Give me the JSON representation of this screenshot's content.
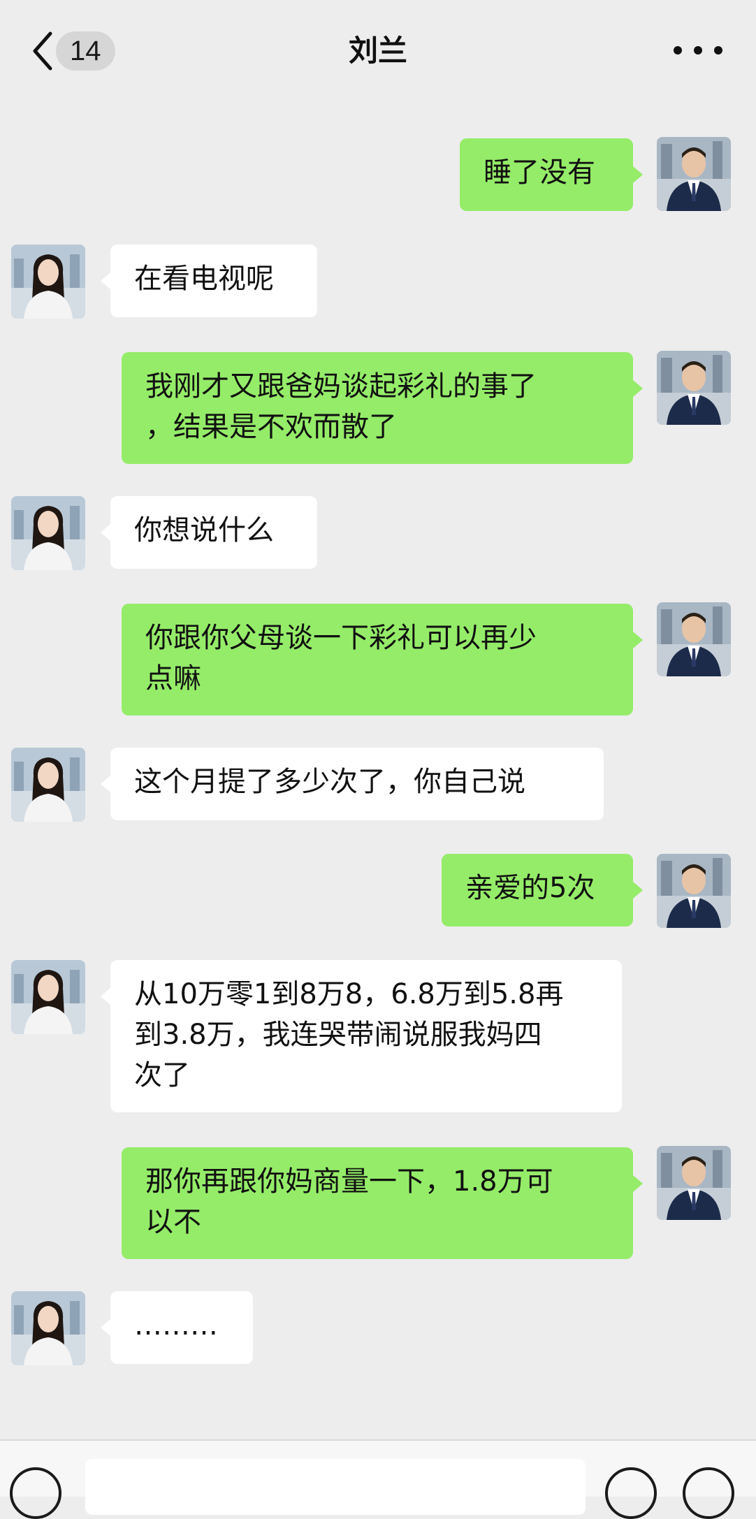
{
  "header": {
    "unread_count": "14",
    "title": "刘兰"
  },
  "messages": [
    {
      "side": "out",
      "text": "睡了没有"
    },
    {
      "side": "in",
      "text": "在看电视呢"
    },
    {
      "side": "out",
      "text": "我刚才又跟爸妈谈起彩礼的事了\n，结果是不欢而散了"
    },
    {
      "side": "in",
      "text": "你想说什么"
    },
    {
      "side": "out",
      "text": "你跟你父母谈一下彩礼可以再少\n点嘛"
    },
    {
      "side": "in",
      "text": "这个月提了多少次了，你自己说"
    },
    {
      "side": "out",
      "text": "亲爱的5次"
    },
    {
      "side": "in",
      "text": "从10万零1到8万8，6.8万到5.8再\n到3.8万，我连哭带闹说服我妈四\n次了"
    },
    {
      "side": "out",
      "text": "那你再跟你妈商量一下，1.8万可\n以不"
    },
    {
      "side": "in",
      "text": "………"
    }
  ],
  "input_bar": {
    "icons": [
      "voice-icon",
      "emoji-icon",
      "plus-icon"
    ]
  }
}
